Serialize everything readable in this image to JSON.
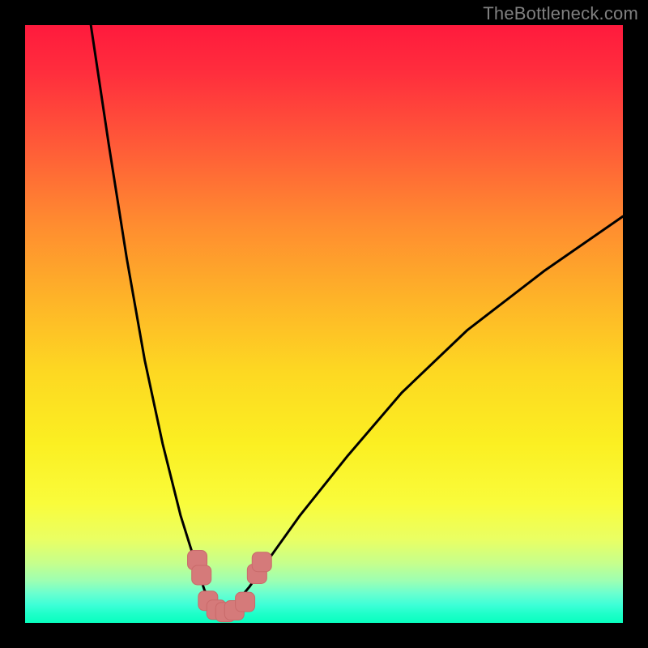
{
  "watermark": "TheBottleneck.com",
  "colors": {
    "frame": "#000000",
    "curve_stroke": "#000000",
    "marker_fill": "#d57a7a",
    "marker_stroke": "#c96a6a"
  },
  "chart_data": {
    "type": "line",
    "title": "",
    "xlabel": "",
    "ylabel": "",
    "xlim": [
      0,
      100
    ],
    "ylim": [
      0,
      100
    ],
    "grid": false,
    "note": "Values estimated from pixel positions; y is percentage from top to bottom (higher y = lower on image). Bottleneck-style V curve with minimum near x≈33.",
    "series": [
      {
        "name": "left_branch",
        "x": [
          11,
          14,
          17,
          20,
          23,
          26,
          28.5,
          30,
          31.5,
          33
        ],
        "y": [
          0,
          20,
          39,
          56,
          70,
          82,
          90,
          94.5,
          97,
          98.5
        ]
      },
      {
        "name": "right_branch",
        "x": [
          33,
          35,
          37.5,
          41,
          46,
          54,
          63,
          74,
          87,
          100
        ],
        "y": [
          98.5,
          97,
          94,
          89,
          82,
          72,
          61.5,
          51,
          41,
          32
        ]
      }
    ],
    "markers": {
      "name": "highlighted_points",
      "shape": "rounded",
      "points": [
        {
          "x": 28.8,
          "y": 89.5
        },
        {
          "x": 29.5,
          "y": 92.0
        },
        {
          "x": 30.6,
          "y": 96.3
        },
        {
          "x": 32.0,
          "y": 97.8
        },
        {
          "x": 33.5,
          "y": 98.2
        },
        {
          "x": 35.0,
          "y": 97.9
        },
        {
          "x": 36.8,
          "y": 96.5
        },
        {
          "x": 38.8,
          "y": 91.8
        },
        {
          "x": 39.6,
          "y": 89.8
        }
      ]
    }
  }
}
